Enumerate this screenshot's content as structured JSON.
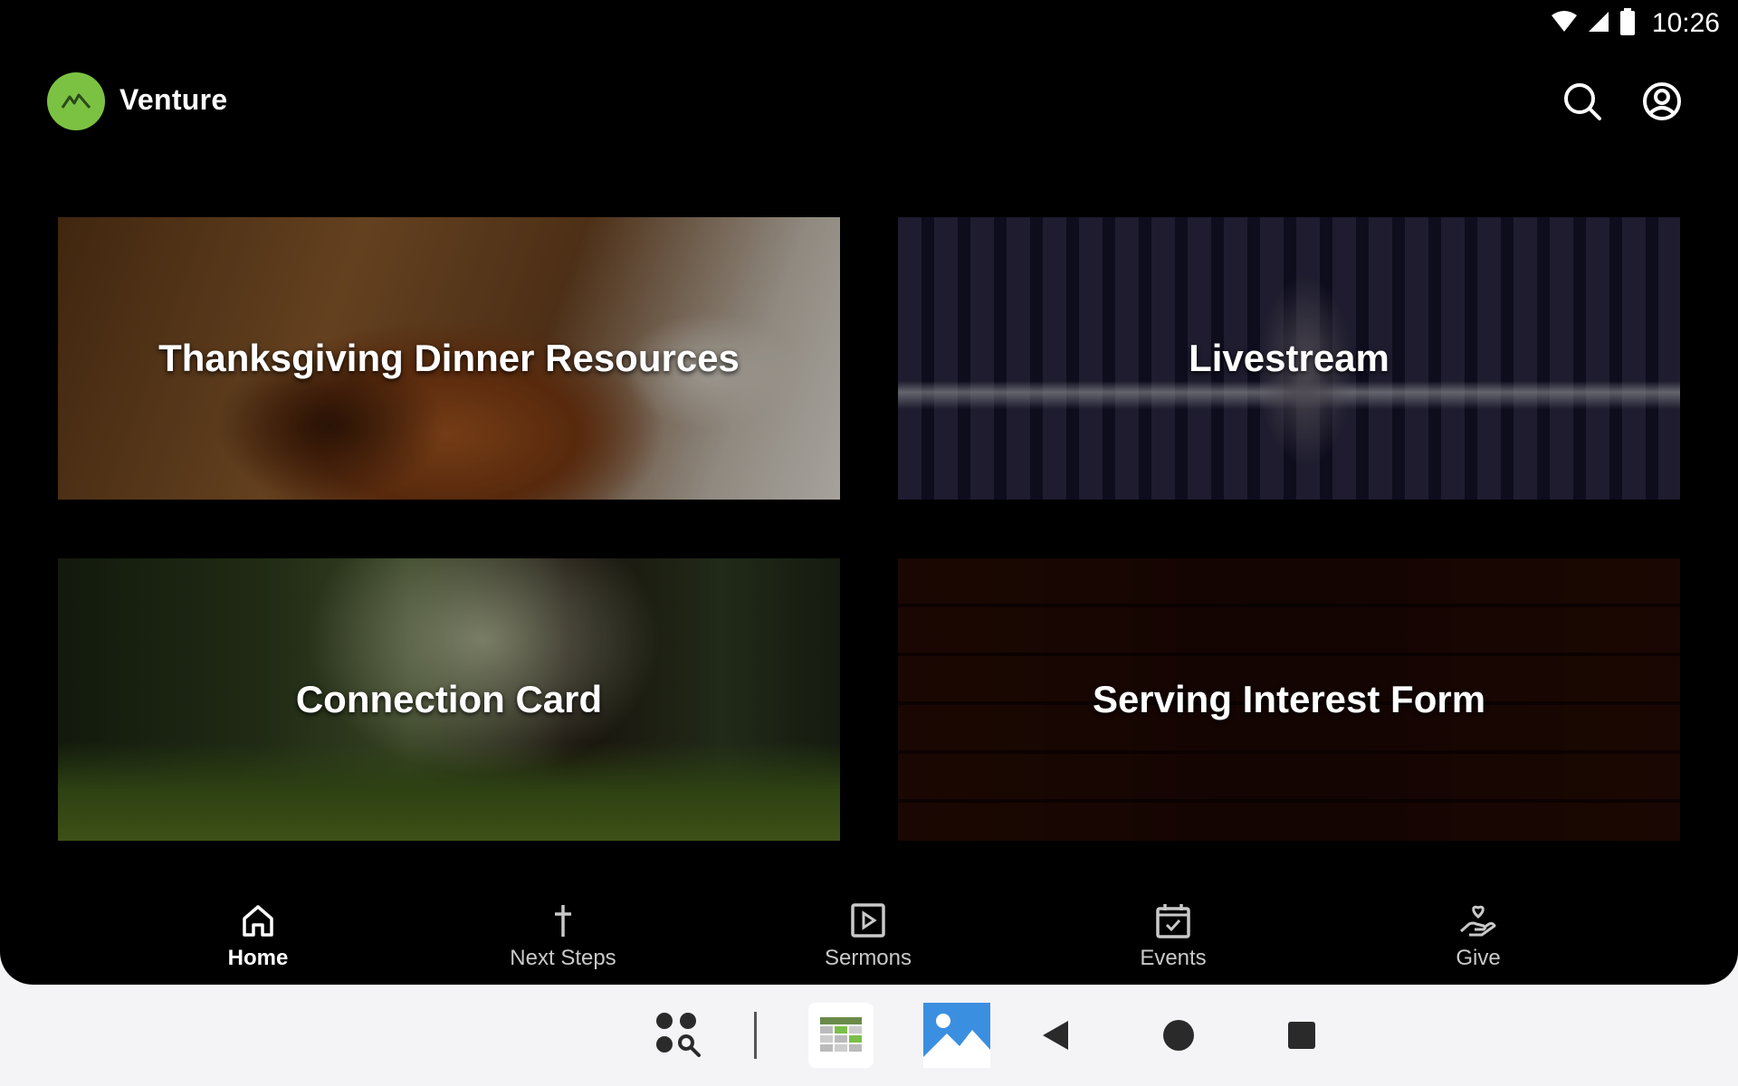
{
  "status_bar": {
    "time": "10:26"
  },
  "header": {
    "brand": "Venture"
  },
  "cards": [
    {
      "title": "Thanksgiving Dinner Resources"
    },
    {
      "title": "Livestream"
    },
    {
      "title": "Connection Card"
    },
    {
      "title": "Serving Interest Form"
    }
  ],
  "bottom_nav": {
    "items": [
      {
        "label": "Home",
        "icon": "home-icon",
        "active": true
      },
      {
        "label": "Next Steps",
        "icon": "cross-icon",
        "active": false
      },
      {
        "label": "Sermons",
        "icon": "play-box-icon",
        "active": false
      },
      {
        "label": "Events",
        "icon": "calendar-check-icon",
        "active": false
      },
      {
        "label": "Give",
        "icon": "give-hand-icon",
        "active": false
      }
    ]
  },
  "colors": {
    "brand_green": "#7cc242",
    "background": "#000000"
  }
}
